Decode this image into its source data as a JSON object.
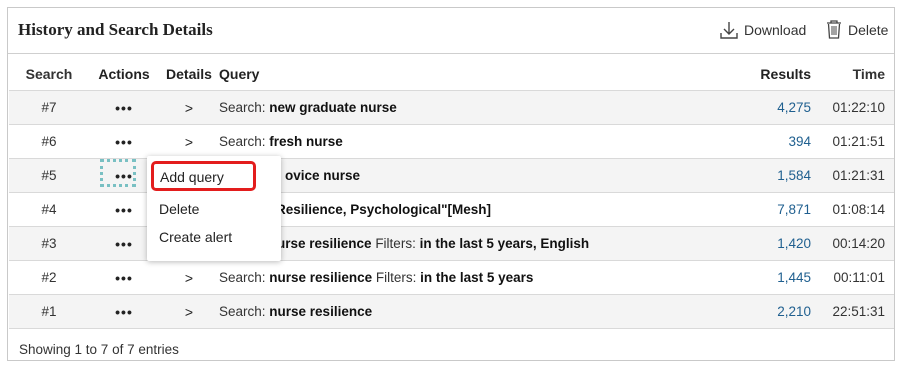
{
  "header": {
    "title": "History and Search Details",
    "download_label": "Download",
    "delete_label": "Delete"
  },
  "table": {
    "columns": [
      "Search",
      "Actions",
      "Details",
      "Query",
      "Results",
      "Time"
    ],
    "rows": [
      {
        "search": "#7",
        "actions": "•••",
        "details": ">",
        "prefix": "Search: ",
        "term": "new graduate nurse",
        "filter_label": "",
        "filter_term": "",
        "results": "4,275",
        "time": "01:22:10"
      },
      {
        "search": "#6",
        "actions": "•••",
        "details": ">",
        "prefix": "Search: ",
        "term": "fresh nurse",
        "filter_label": "",
        "filter_term": "",
        "results": "394",
        "time": "01:21:51"
      },
      {
        "search": "#5",
        "actions": "•••",
        "details": "",
        "prefix": "",
        "term": "ovice nurse",
        "filter_label": "",
        "filter_term": "",
        "results": "1,584",
        "time": "01:21:31"
      },
      {
        "search": "#4",
        "actions": "•••",
        "details": "",
        "prefix": "",
        "term": "Resilience, Psychological\"[Mesh]",
        "filter_label": "",
        "filter_term": "",
        "results": "7,871",
        "time": "01:08:14"
      },
      {
        "search": "#3",
        "actions": "•••",
        "details": "",
        "prefix": "",
        "term": "urse resilience",
        "filter_label": " Filters: ",
        "filter_term": "in the last 5 years, English",
        "results": "1,420",
        "time": "00:14:20"
      },
      {
        "search": "#2",
        "actions": "•••",
        "details": ">",
        "prefix": "Search: ",
        "term": "nurse resilience",
        "filter_label": " Filters: ",
        "filter_term": "in the last 5 years",
        "results": "1,445",
        "time": "00:11:01"
      },
      {
        "search": "#1",
        "actions": "•••",
        "details": ">",
        "prefix": "Search: ",
        "term": "nurse resilience",
        "filter_label": "",
        "filter_term": "",
        "results": "2,210",
        "time": "22:51:31"
      }
    ]
  },
  "dropdown": {
    "items": [
      "Add query",
      "Delete",
      "Create alert"
    ],
    "highlight_color": "#e31d1d"
  },
  "footer": {
    "text": "Showing 1 to 7 of 7 entries"
  },
  "icons": {
    "download": "download-icon",
    "delete": "trash-icon"
  }
}
